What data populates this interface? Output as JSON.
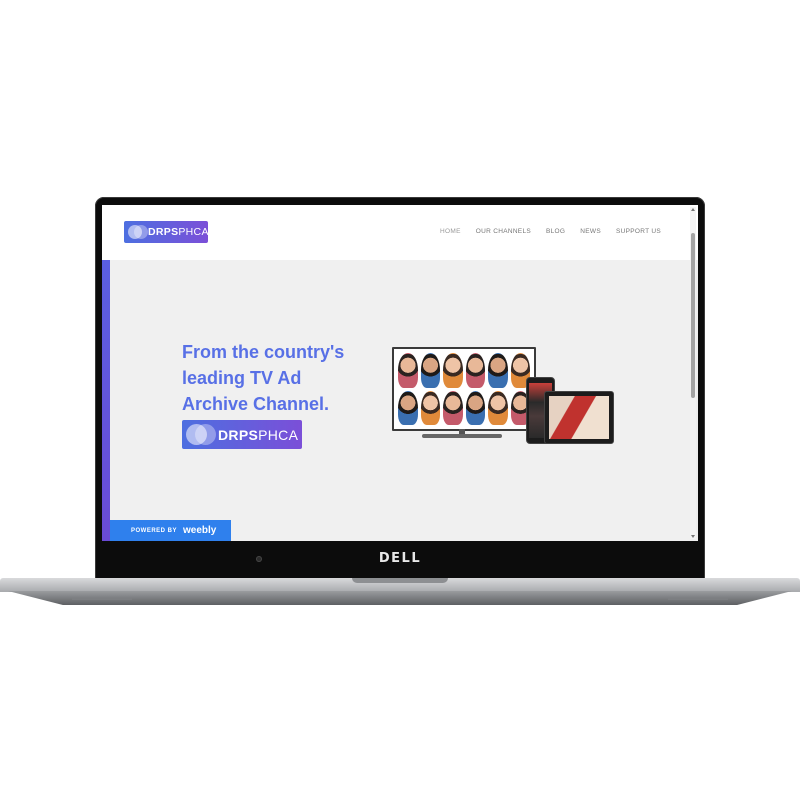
{
  "laptop": {
    "brand": "DELL"
  },
  "site": {
    "logo": {
      "bold": "DRPS",
      "regular": "PHCA"
    },
    "nav": [
      {
        "label": "HOME",
        "active": true
      },
      {
        "label": "OUR CHANNELS"
      },
      {
        "label": "BLOG"
      },
      {
        "label": "NEWS"
      },
      {
        "label": "SUPPORT US"
      }
    ],
    "hero": {
      "title_lines": [
        "From the country's",
        "leading TV Ad",
        "Archive Channel."
      ],
      "logo": {
        "bold": "DRPS",
        "regular": "PHCA"
      }
    },
    "footer_badge": {
      "prefix": "POWERED BY",
      "brand": "weebly"
    }
  },
  "colors": {
    "accent": "#5870e6",
    "logo_gradient_start": "#4d6fe0",
    "logo_gradient_end": "#7b4fd8",
    "badge": "#2f80ed"
  }
}
